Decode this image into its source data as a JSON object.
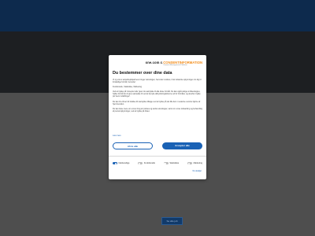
{
  "background": {
    "button_label": "Se alle job"
  },
  "dialog": {
    "logo": {
      "brand": "one.com",
      "amp": "&",
      "partner": "CONSENTINFORMATION",
      "partner_sub": "Consent Management Platform"
    },
    "title": "Du bestemmer over dine data",
    "paragraphs": [
      "Vi og vores samarbejdspartnere bruger teknologier, herunder cookies, til at indsamle oplysninger om dig til forskellige formål, herunder:",
      "Funktionelle, Statistiske, Marketing",
      "Ved at trykke på 'Accepter alle' giver du samtykke til alle disse formål. Du kan også vælge at tilkendegive, hvilke formål du vil give samtykke til ved at benytte afkrydsningsfelterne ud for formålet, og derefter trykke på 'Gem indstillinger'.",
      "Du kan til enhver tid trække dit samtykke tilbage ved at trykke på det lille ikon i nederste venstre hjørne af hjemmesiden.",
      "Du kan læse mere om vores brug af cookies og andre teknologier, samt om vores indsamling og behandling af personoplysninger, ved at trykke på linket."
    ],
    "read_more": "Læs mere",
    "reject_label": "Afvis alle",
    "accept_label": "Accepter alle",
    "toggles": [
      {
        "label": "Nødvendige",
        "on": true
      },
      {
        "label": "Funktionelle",
        "on": false
      },
      {
        "label": "Statistiske",
        "on": false
      },
      {
        "label": "Marketing",
        "on": false
      }
    ],
    "details_link": "Vis detaljer"
  },
  "colors": {
    "accent": "#1a62b5",
    "brand_orange": "#f28c1a",
    "topbar": "#0d2a4d"
  }
}
